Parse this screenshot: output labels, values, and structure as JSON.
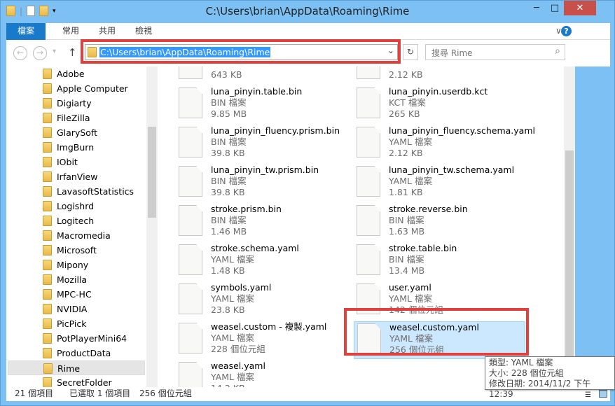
{
  "window": {
    "title": "C:\\Users\\brian\\AppData\\Roaming\\Rime",
    "minimize": "─",
    "maximize": "□",
    "close": "✕"
  },
  "ribbon": {
    "tabs": [
      "檔案",
      "常用",
      "共用",
      "檢視"
    ],
    "expand": "∨",
    "help": "?"
  },
  "nav": {
    "back": "←",
    "forward": "→",
    "recent": "▾",
    "up": "↑",
    "address": "C:\\Users\\brian\\AppData\\Roaming\\Rime",
    "dropdown": "⌄",
    "refresh": "↻",
    "search_placeholder": "搜尋 Rime",
    "search_icon": "⌕"
  },
  "sidebar": {
    "items": [
      "Adobe",
      "Apple Computer",
      "Digiarty",
      "FileZilla",
      "GlarySoft",
      "ImgBurn",
      "IObit",
      "IrfanView",
      "LavasoftStatistics",
      "Logishrd",
      "Logitech",
      "Macromedia",
      "Microsoft",
      "Mipony",
      "Mozilla",
      "MPC-HC",
      "NVIDIA",
      "PicPick",
      "PotPlayerMini64",
      "ProductData",
      "Rime",
      "SecretFolder"
    ],
    "selected": "Rime"
  },
  "files": [
    {
      "name": "",
      "type": "",
      "size": "643 KB"
    },
    {
      "name": "",
      "type": "",
      "size": "2.12 KB"
    },
    {
      "name": "luna_pinyin.table.bin",
      "type": "BIN 檔案",
      "size": "9.85 MB"
    },
    {
      "name": "luna_pinyin.userdb.kct",
      "type": "KCT 檔案",
      "size": "265 KB"
    },
    {
      "name": "luna_pinyin_fluency.prism.bin",
      "type": "BIN 檔案",
      "size": "39.8 KB"
    },
    {
      "name": "luna_pinyin_fluency.schema.yaml",
      "type": "YAML 檔案",
      "size": "2.12 KB"
    },
    {
      "name": "luna_pinyin_tw.prism.bin",
      "type": "BIN 檔案",
      "size": "39.8 KB"
    },
    {
      "name": "luna_pinyin_tw.schema.yaml",
      "type": "YAML 檔案",
      "size": "1.81 KB"
    },
    {
      "name": "stroke.prism.bin",
      "type": "BIN 檔案",
      "size": "1.46 MB"
    },
    {
      "name": "stroke.reverse.bin",
      "type": "BIN 檔案",
      "size": "1.63 MB"
    },
    {
      "name": "stroke.schema.yaml",
      "type": "YAML 檔案",
      "size": "1.48 KB"
    },
    {
      "name": "stroke.table.bin",
      "type": "BIN 檔案",
      "size": "13.4 MB"
    },
    {
      "name": "symbols.yaml",
      "type": "YAML 檔案",
      "size": "23.8 KB"
    },
    {
      "name": "user.yaml",
      "type": "YAML 檔案",
      "size": "142 個位元組"
    },
    {
      "name": "weasel.custom - 複製.yaml",
      "type": "YAML 檔案",
      "size": "228 個位元組"
    },
    {
      "name": "weasel.custom.yaml",
      "type": "YAML 檔案",
      "size": "256 個位元組"
    },
    {
      "name": "weasel.yaml",
      "type": "YAML 檔案",
      "size": "14.2 KB"
    }
  ],
  "selected_file": "weasel.custom.yaml",
  "tooltip": {
    "type": "類型: YAML 檔案",
    "size": "大小: 228 個位元組",
    "modified": "修改日期: 2014/11/2 下午 12:39"
  },
  "status": {
    "count": "21 個項目",
    "selected": "已選取 1 個項目",
    "size": "256 個位元組"
  },
  "colors": {
    "accent": "#1979ca",
    "highlight": "#e0413c",
    "selection": "#cce8ff"
  }
}
